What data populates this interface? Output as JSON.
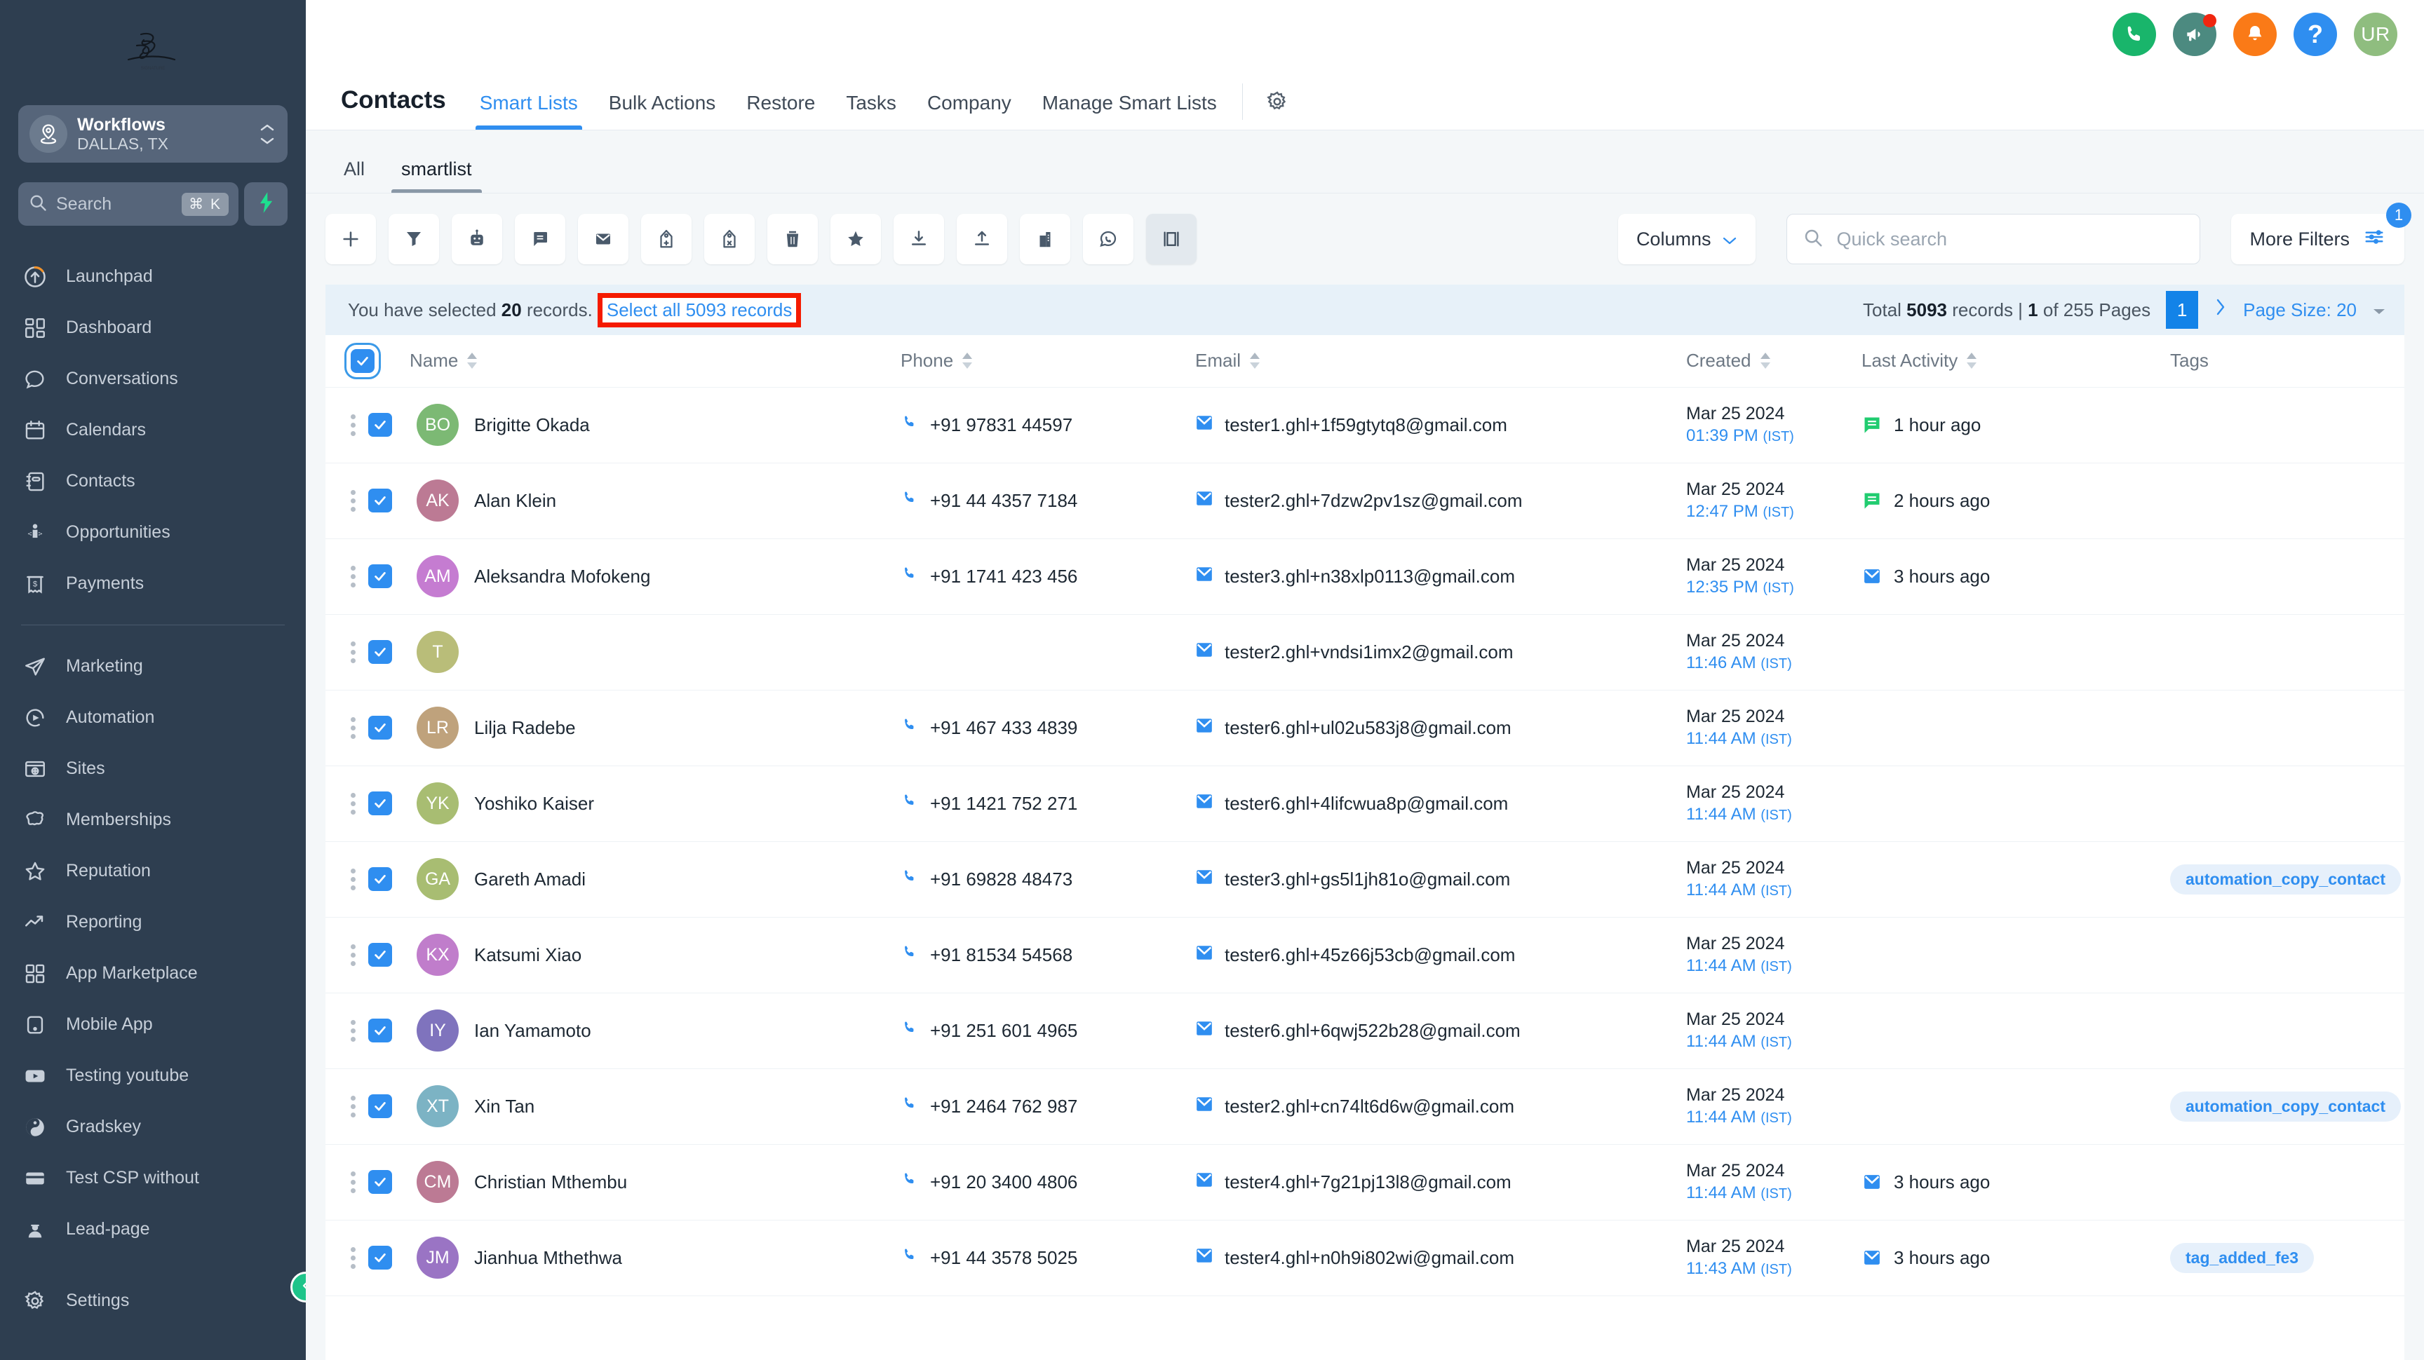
{
  "sidebar": {
    "logo_alt": "brand-signature-logo",
    "location": {
      "name": "Workflows",
      "sub": "DALLAS, TX",
      "icon": "location-pin-icon"
    },
    "search": {
      "placeholder": "Search",
      "shortcut": "⌘ K",
      "icon": "search-icon",
      "bolt_icon": "lightning-bolt-icon"
    },
    "items": [
      {
        "label": "Launchpad",
        "icon": "launchpad-icon"
      },
      {
        "label": "Dashboard",
        "icon": "dashboard-grid-icon"
      },
      {
        "label": "Conversations",
        "icon": "chat-bubble-icon"
      },
      {
        "label": "Calendars",
        "icon": "calendar-icon"
      },
      {
        "label": "Contacts",
        "icon": "contact-book-icon"
      },
      {
        "label": "Opportunities",
        "icon": "opportunities-icon"
      },
      {
        "label": "Payments",
        "icon": "payments-receipt-icon"
      }
    ],
    "items2": [
      {
        "label": "Marketing",
        "icon": "paper-plane-icon"
      },
      {
        "label": "Automation",
        "icon": "automation-play-icon"
      },
      {
        "label": "Sites",
        "icon": "sites-globe-icon"
      },
      {
        "label": "Memberships",
        "icon": "memberships-badge-icon"
      },
      {
        "label": "Reputation",
        "icon": "star-outline-icon"
      },
      {
        "label": "Reporting",
        "icon": "trend-line-icon"
      },
      {
        "label": "App Marketplace",
        "icon": "app-grid-icon"
      },
      {
        "label": "Mobile App",
        "icon": "mobile-app-icon"
      },
      {
        "label": "Testing youtube",
        "icon": "youtube-icon"
      },
      {
        "label": "Gradskey",
        "icon": "gradskey-circle-icon"
      },
      {
        "label": "Test CSP without",
        "icon": "card-icon"
      },
      {
        "label": "Lead-page",
        "icon": "lead-person-icon"
      }
    ],
    "settings": {
      "label": "Settings",
      "icon": "gear-icon"
    },
    "collapse_icon": "collapse-chevron-left-icon"
  },
  "topbar": {
    "icons": [
      {
        "name": "phone-icon",
        "glyph": "phone"
      },
      {
        "name": "announcement-megaphone-icon",
        "glyph": "megaphone",
        "badge": true
      },
      {
        "name": "notification-bell-icon",
        "glyph": "bell"
      },
      {
        "name": "help-icon",
        "glyph": "?"
      }
    ],
    "avatar_initials": "UR"
  },
  "header": {
    "title": "Contacts",
    "tabs": [
      {
        "label": "Smart Lists",
        "active": true
      },
      {
        "label": "Bulk Actions",
        "active": false
      },
      {
        "label": "Restore",
        "active": false
      },
      {
        "label": "Tasks",
        "active": false
      },
      {
        "label": "Company",
        "active": false
      },
      {
        "label": "Manage Smart Lists",
        "active": false
      }
    ],
    "settings_icon": "gear-icon"
  },
  "subtabs": [
    {
      "label": "All",
      "active": false
    },
    {
      "label": "smartlist",
      "active": true
    }
  ],
  "toolbar": {
    "buttons": [
      {
        "name": "add-contact-button",
        "icon": "plus-icon"
      },
      {
        "name": "filter-button",
        "icon": "funnel-icon"
      },
      {
        "name": "bot-button",
        "icon": "robot-icon"
      },
      {
        "name": "sms-button",
        "icon": "message-icon"
      },
      {
        "name": "email-button",
        "icon": "envelope-icon"
      },
      {
        "name": "add-tag-button",
        "icon": "tag-plus-icon"
      },
      {
        "name": "remove-tag-button",
        "icon": "tag-remove-icon"
      },
      {
        "name": "delete-button",
        "icon": "trash-icon"
      },
      {
        "name": "favorite-button",
        "icon": "star-filled-icon"
      },
      {
        "name": "import-button",
        "icon": "download-icon"
      },
      {
        "name": "export-button",
        "icon": "upload-icon"
      },
      {
        "name": "company-button",
        "icon": "building-icon"
      },
      {
        "name": "whatsapp-button",
        "icon": "whatsapp-icon"
      },
      {
        "name": "merge-button",
        "icon": "merge-icon",
        "selected": true
      }
    ],
    "columns_label": "Columns",
    "columns_caret_icon": "chevron-down-icon",
    "quick_search_placeholder": "Quick search",
    "quick_search_value": "",
    "quick_search_icon": "search-icon",
    "more_filters_label": "More Filters",
    "more_filters_icon": "sliders-icon",
    "more_filters_badge": "1"
  },
  "selection_bar": {
    "prefix": "You have selected",
    "count": "20",
    "suffix": "records.",
    "select_all_link": "Select all 5093 records",
    "total_prefix": "Total",
    "total_count": "5093",
    "total_mid": "records |",
    "current_page": "1",
    "pages_suffix": "of 255 Pages",
    "page_pill": "1",
    "next_icon": "chevron-right-icon",
    "page_size_label": "Page Size: 20",
    "page_size_caret_icon": "caret-down-icon"
  },
  "table": {
    "columns": [
      {
        "key": "select",
        "label": ""
      },
      {
        "key": "name",
        "label": "Name",
        "sortable": true
      },
      {
        "key": "phone",
        "label": "Phone",
        "sortable": true
      },
      {
        "key": "email",
        "label": "Email",
        "sortable": true
      },
      {
        "key": "created",
        "label": "Created",
        "sortable": true
      },
      {
        "key": "activity",
        "label": "Last Activity",
        "sortable": true
      },
      {
        "key": "tags",
        "label": "Tags",
        "sortable": false
      }
    ],
    "header_checkbox_checked": true,
    "rows": [
      {
        "initials": "BO",
        "avatar_color": "#7cb974",
        "name": "Brigitte Okada",
        "phone": "+91 97831 44597",
        "email": "tester1.ghl+1f59gtytq8@gmail.com",
        "created_date": "Mar 25 2024",
        "created_time": "01:39 PM",
        "created_tz": "(IST)",
        "activity": "1 hour ago",
        "activity_icon": "sms-green-icon",
        "tag": "",
        "checked": true
      },
      {
        "initials": "AK",
        "avatar_color": "#bc7a94",
        "name": "Alan Klein",
        "phone": "+91 44 4357 7184",
        "email": "tester2.ghl+7dzw2pv1sz@gmail.com",
        "created_date": "Mar 25 2024",
        "created_time": "12:47 PM",
        "created_tz": "(IST)",
        "activity": "2 hours ago",
        "activity_icon": "sms-green-icon",
        "tag": "",
        "checked": true
      },
      {
        "initials": "AM",
        "avatar_color": "#c57cd1",
        "name": "Aleksandra Mofokeng",
        "phone": "+91 1741 423 456",
        "email": "tester3.ghl+n38xlp0113@gmail.com",
        "created_date": "Mar 25 2024",
        "created_time": "12:35 PM",
        "created_tz": "(IST)",
        "activity": "3 hours ago",
        "activity_icon": "email-blue-icon",
        "tag": "",
        "checked": true
      },
      {
        "initials": "T",
        "avatar_color": "#b9bd79",
        "name": "",
        "phone": "",
        "email": "tester2.ghl+vndsi1imx2@gmail.com",
        "created_date": "Mar 25 2024",
        "created_time": "11:46 AM",
        "created_tz": "(IST)",
        "activity": "",
        "activity_icon": "",
        "tag": "",
        "checked": true
      },
      {
        "initials": "LR",
        "avatar_color": "#bfa27c",
        "name": "Lilja Radebe",
        "phone": "+91 467 433 4839",
        "email": "tester6.ghl+ul02u583j8@gmail.com",
        "created_date": "Mar 25 2024",
        "created_time": "11:44 AM",
        "created_tz": "(IST)",
        "activity": "",
        "activity_icon": "",
        "tag": "",
        "checked": true
      },
      {
        "initials": "YK",
        "avatar_color": "#a8bd72",
        "name": "Yoshiko Kaiser",
        "phone": "+91 1421 752 271",
        "email": "tester6.ghl+4lifcwua8p@gmail.com",
        "created_date": "Mar 25 2024",
        "created_time": "11:44 AM",
        "created_tz": "(IST)",
        "activity": "",
        "activity_icon": "",
        "tag": "",
        "checked": true
      },
      {
        "initials": "GA",
        "avatar_color": "#a8bd72",
        "name": "Gareth Amadi",
        "phone": "+91 69828 48473",
        "email": "tester3.ghl+gs5l1jh81o@gmail.com",
        "created_date": "Mar 25 2024",
        "created_time": "11:44 AM",
        "created_tz": "(IST)",
        "activity": "",
        "activity_icon": "",
        "tag": "automation_copy_contact",
        "checked": true
      },
      {
        "initials": "KX",
        "avatar_color": "#c07dcb",
        "name": "Katsumi Xiao",
        "phone": "+91 81534 54568",
        "email": "tester6.ghl+45z66j53cb@gmail.com",
        "created_date": "Mar 25 2024",
        "created_time": "11:44 AM",
        "created_tz": "(IST)",
        "activity": "",
        "activity_icon": "",
        "tag": "",
        "checked": true
      },
      {
        "initials": "IY",
        "avatar_color": "#7f73bd",
        "name": "Ian Yamamoto",
        "phone": "+91 251 601 4965",
        "email": "tester6.ghl+6qwj522b28@gmail.com",
        "created_date": "Mar 25 2024",
        "created_time": "11:44 AM",
        "created_tz": "(IST)",
        "activity": "",
        "activity_icon": "",
        "tag": "",
        "checked": true
      },
      {
        "initials": "XT",
        "avatar_color": "#7cb3c4",
        "name": "Xin Tan",
        "phone": "+91 2464 762 987",
        "email": "tester2.ghl+cn74lt6d6w@gmail.com",
        "created_date": "Mar 25 2024",
        "created_time": "11:44 AM",
        "created_tz": "(IST)",
        "activity": "",
        "activity_icon": "",
        "tag": "automation_copy_contact",
        "checked": true
      },
      {
        "initials": "CM",
        "avatar_color": "#bc7a94",
        "name": "Christian Mthembu",
        "phone": "+91 20 3400 4806",
        "email": "tester4.ghl+7g21pj13l8@gmail.com",
        "created_date": "Mar 25 2024",
        "created_time": "11:44 AM",
        "created_tz": "(IST)",
        "activity": "3 hours ago",
        "activity_icon": "email-blue-icon",
        "tag": "",
        "checked": true
      },
      {
        "initials": "JM",
        "avatar_color": "#9a74c4",
        "name": "Jianhua Mthethwa",
        "phone": "+91 44 3578 5025",
        "email": "tester4.ghl+n0h9i802wi@gmail.com",
        "created_date": "Mar 25 2024",
        "created_time": "11:43 AM",
        "created_tz": "(IST)",
        "activity": "3 hours ago",
        "activity_icon": "email-blue-icon",
        "tag": "tag_added_fe3",
        "checked": true
      }
    ]
  },
  "colors": {
    "accent_blue": "#2f8ef0",
    "sidebar_bg": "#2e3e50",
    "highlight_red": "#f51b00",
    "selection_bar_bg": "#e7f1f9",
    "green": "#19b56b",
    "orange": "#fa7a17"
  }
}
